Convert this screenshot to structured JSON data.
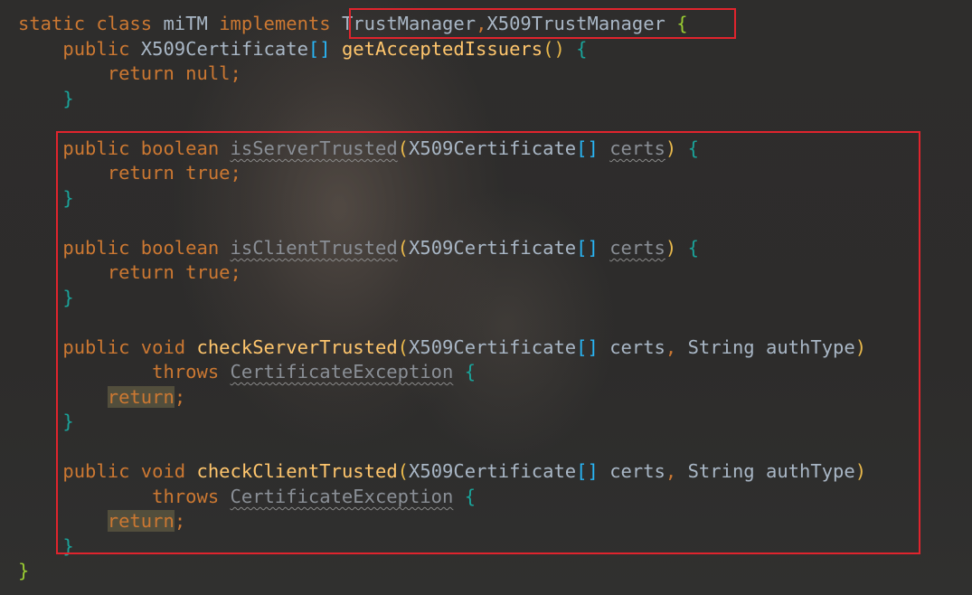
{
  "code": {
    "l1": {
      "static": "static",
      "class": "class",
      "name": "miTM",
      "implements": "implements",
      "iface1": "TrustManager",
      "comma": ",",
      "iface2": "X509TrustManager",
      "brace": "{"
    },
    "l2": {
      "public": "public",
      "type": "X509Certificate",
      "arr": "[]",
      "method": "getAcceptedIssuers",
      "parens": "()",
      "brace": "{"
    },
    "l3": {
      "return": "return",
      "value": "null",
      "semi": ";"
    },
    "l4": {
      "brace": "}"
    },
    "l6": {
      "public": "public",
      "boolean": "boolean",
      "method": "isServerTrusted",
      "open": "(",
      "type": "X509Certificate",
      "arr": "[]",
      "param": "certs",
      "close": ")",
      "brace": "{"
    },
    "l7": {
      "return": "return",
      "value": "true",
      "semi": ";"
    },
    "l8": {
      "brace": "}"
    },
    "l10": {
      "public": "public",
      "boolean": "boolean",
      "method": "isClientTrusted",
      "open": "(",
      "type": "X509Certificate",
      "arr": "[]",
      "param": "certs",
      "close": ")",
      "brace": "{"
    },
    "l11": {
      "return": "return",
      "value": "true",
      "semi": ";"
    },
    "l12": {
      "brace": "}"
    },
    "l14": {
      "public": "public",
      "void": "void",
      "method": "checkServerTrusted",
      "open": "(",
      "type": "X509Certificate",
      "arr": "[]",
      "param1": "certs",
      "comma": ",",
      "type2": "String",
      "param2": "authType",
      "close": ")"
    },
    "l15": {
      "throws": "throws",
      "exception": "CertificateException",
      "brace": "{"
    },
    "l16": {
      "return": "return",
      "semi": ";"
    },
    "l17": {
      "brace": "}"
    },
    "l19": {
      "public": "public",
      "void": "void",
      "method": "checkClientTrusted",
      "open": "(",
      "type": "X509Certificate",
      "arr": "[]",
      "param1": "certs",
      "comma": ",",
      "type2": "String",
      "param2": "authType",
      "close": ")"
    },
    "l20": {
      "throws": "throws",
      "exception": "CertificateException",
      "brace": "{"
    },
    "l21": {
      "return": "return",
      "semi": ";"
    },
    "l22": {
      "brace": "}"
    },
    "l23": {
      "brace": "}"
    }
  },
  "colors": {
    "background": "#2b2b2b",
    "keyword": "#cc7832",
    "method": "#ffc66d",
    "text": "#a9b7c6",
    "bracket": "#29b6f6",
    "annotation_box": "#e0242d"
  }
}
